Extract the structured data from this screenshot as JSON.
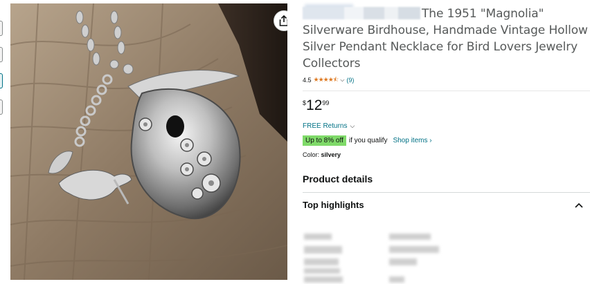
{
  "product": {
    "title_visible": "The 1951 \"Magnolia\" Silverware Birdhouse, Handmade Vintage Hollow Silver Pendant Necklace for Bird Lovers Jewelry Collectors",
    "rating": "4.5",
    "rating_stars": "★★★★⯪",
    "rating_chevron": "⌵",
    "rating_count": "(9)",
    "price_symbol": "$",
    "price_whole": "12",
    "price_fraction": "99",
    "returns_label": "FREE Returns",
    "returns_chevron": "⌵",
    "deal_badge": "Up to 8% off",
    "deal_text": "if you qualify",
    "shop_items_label": "Shop items ›",
    "color_label": "Color:",
    "color_value": "silvery",
    "product_details_title": "Product details",
    "top_highlights_title": "Top highlights"
  },
  "image": {
    "alt": "Silver spoon birdhouse pendant necklace on weathered wood",
    "share_icon": "share-icon"
  },
  "colors": {
    "link": "#007185",
    "stars": "#de7921",
    "deal_badge_bg": "#7fda69",
    "text": "#0f1111",
    "title_text": "#565959"
  }
}
